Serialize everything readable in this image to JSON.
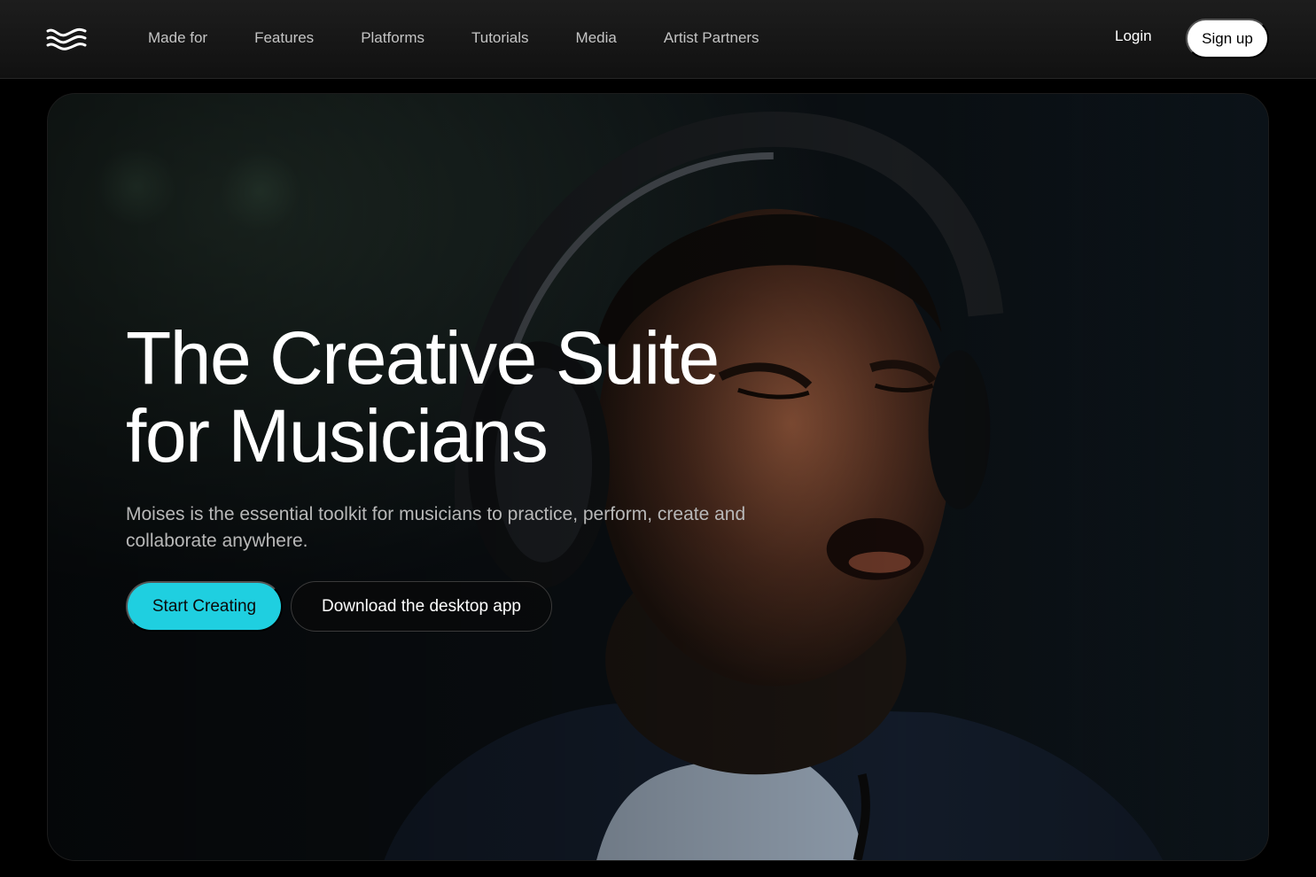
{
  "nav": {
    "logo_icon": "moises-wave-logo-icon",
    "links": [
      "Made for",
      "Features",
      "Platforms",
      "Tutorials",
      "Media",
      "Artist Partners"
    ],
    "login_label": "Login",
    "signup_label": "Sign up"
  },
  "hero": {
    "headline_line1": "The Creative Suite",
    "headline_line2": "for Musicians",
    "subtitle": "Moises is the essential toolkit for musicians to practice, perform, create and collaborate anywhere.",
    "primary_cta": "Start Creating",
    "secondary_cta": "Download the desktop app"
  },
  "colors": {
    "accent": "#1fcfe0",
    "background": "#000000",
    "nav_text": "#c4c4c4"
  }
}
